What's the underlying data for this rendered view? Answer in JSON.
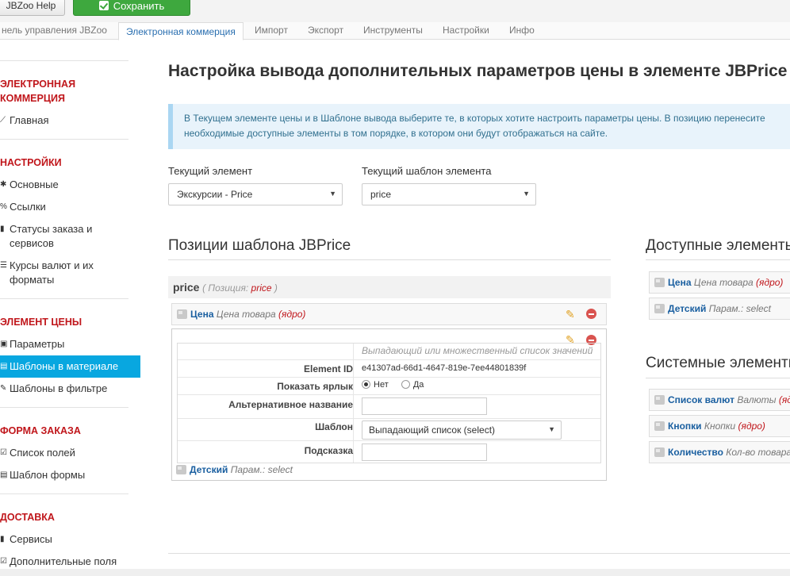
{
  "toolbar": {
    "help_label": "JBZoo Help",
    "save_label": "Сохранить"
  },
  "tabs": [
    {
      "label": "нель управления JBZoo"
    },
    {
      "label": "Электронная коммерция"
    },
    {
      "label": "Импорт"
    },
    {
      "label": "Экспорт"
    },
    {
      "label": "Инструменты"
    },
    {
      "label": "Настройки"
    },
    {
      "label": "Инфо"
    }
  ],
  "sidebar": {
    "h1": "ЭЛЕКТРОННАЯ КОММЕРЦИЯ",
    "i1": "Главная",
    "h2": "НАСТРОЙКИ",
    "i2": "Основные",
    "i3": "Ссылки",
    "i4": "Статусы заказа и сервисов",
    "i5": "Курсы валют и их форматы",
    "h3": "ЭЛЕМЕНТ ЦЕНЫ",
    "i6": "Параметры",
    "i7": "Шаблоны в материале",
    "i8": "Шаблоны в фильтре",
    "h4": "ФОРМА ЗАКАЗА",
    "i9": "Список полей",
    "i10": "Шаблон формы",
    "h5": "ДОСТАВКА",
    "i11": "Сервисы",
    "i12": "Дополнительные поля"
  },
  "main": {
    "title": "Настройка вывода дополнительных параметров цены в элементе JBPrice",
    "alert_line1": "В Текущем элементе цены и в Шаблоне вывода выберите те, в которых хотите настроить параметры цены. В позицию перенесите",
    "alert_line2": "необходимые доступные элементы в том порядке, в котором они будут отображаться на сайте.",
    "current_element_label": "Текущий элемент",
    "current_element_value": "Экскурсии - Price",
    "current_template_label": "Текущий шаблон элемента",
    "current_template_value": "price",
    "positions_title": "Позиции шаблона JBPrice",
    "position_name": "price",
    "position_meta_prefix": "( Позиция: ",
    "position_meta_value": "price",
    "position_meta_suffix": " )",
    "el1_name": "Цена",
    "el1_type": "Цена товара",
    "el1_core": "(ядро)",
    "el2_name": "Детский",
    "el2_type": "Парам.: select",
    "form_desc": "Выпадающий или множественный список значений",
    "form_id_label": "Element ID",
    "form_id_value": "e41307ad-66d1-4647-819e-7ee44801839f",
    "form_show_label": "Показать ярлык",
    "form_no": "Нет",
    "form_yes": "Да",
    "form_alt_label": "Альтернативное название",
    "form_tpl_label": "Шаблон",
    "form_tpl_value": "Выпадающий список (select)",
    "form_hint_label": "Подсказка"
  },
  "available": {
    "title": "Доступные элементы",
    "a1_name": "Цена",
    "a1_type": "Цена товара",
    "a1_core": "(ядро)",
    "a2_name": "Детский",
    "a2_type": "Парам.: select"
  },
  "system": {
    "title": "Системные элементы",
    "s1_name": "Список валют",
    "s1_type": "Валюты",
    "s1_core": "(ядро)",
    "s2_name": "Кнопки",
    "s2_type": "Кнопки",
    "s2_core": "(ядро)",
    "s3_name": "Количество",
    "s3_type": "Кол-во товара"
  },
  "colors": {
    "accent": "#08a7e0",
    "heading_red": "#c0161b",
    "save_green": "#3ea83e",
    "link_blue": "#1a5fa0"
  }
}
